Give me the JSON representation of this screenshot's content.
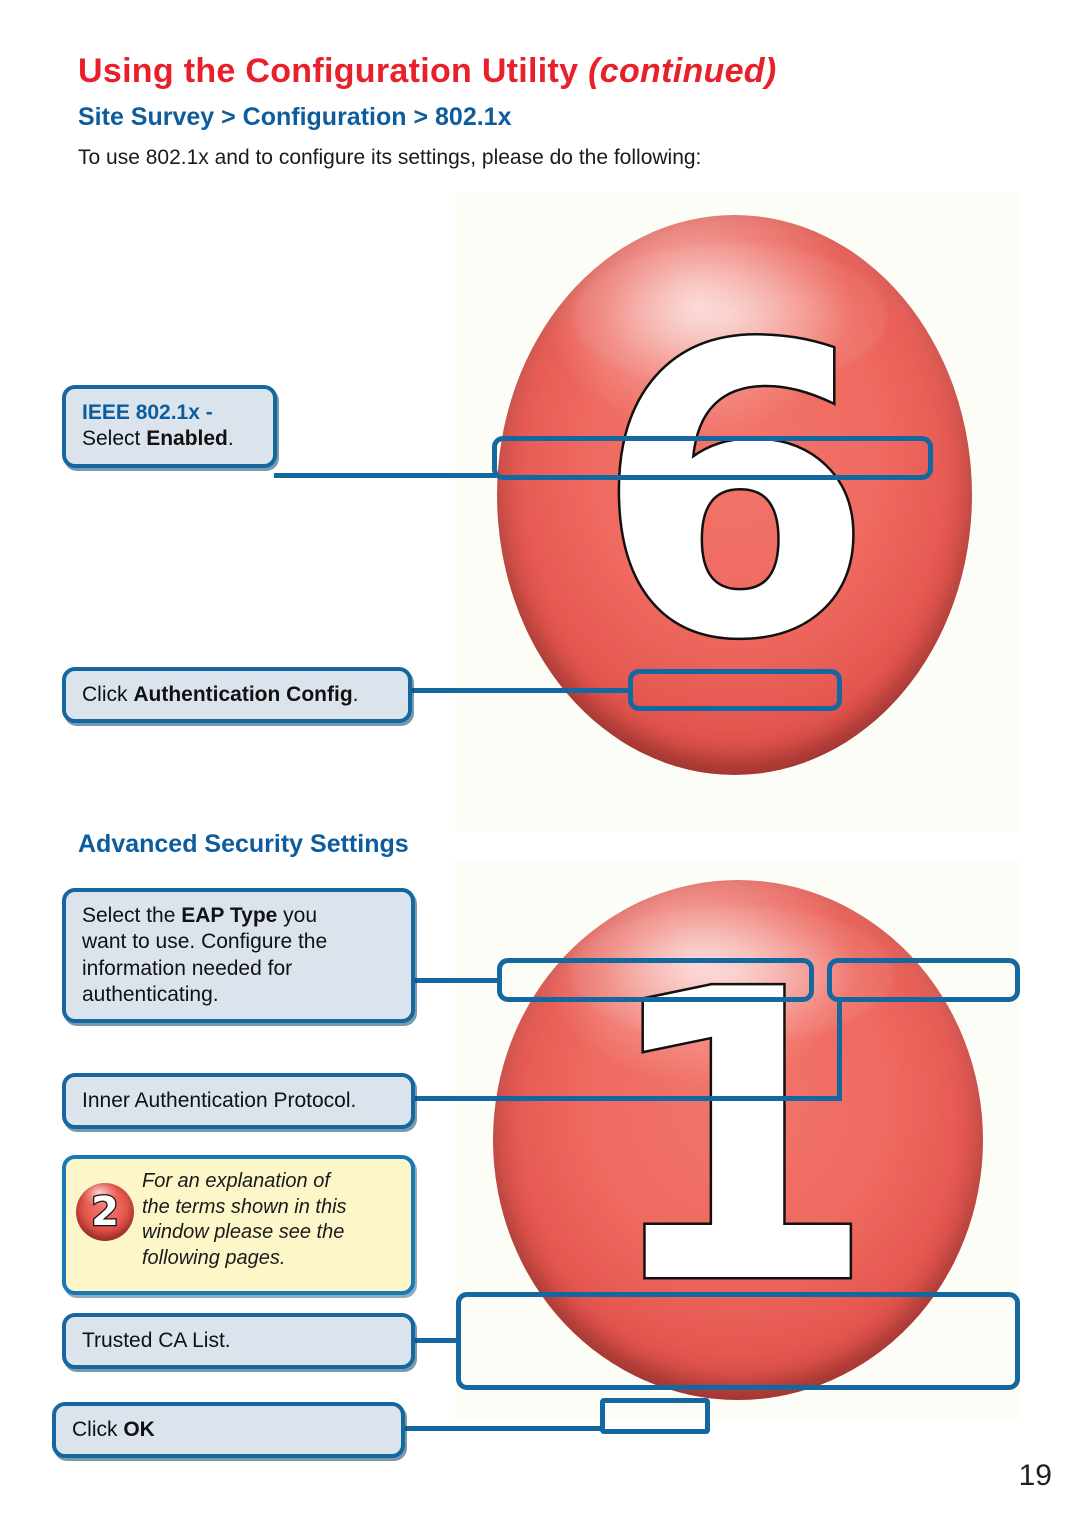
{
  "page": {
    "title_main": "Using the Configuration Utility ",
    "title_continued": "(continued)",
    "subtitle": "Site Survey > Configuration > 802.1x",
    "intro": "To use 802.1x and to configure its settings, please do the following:",
    "section_heading": "Advanced Security Settings",
    "page_number": "19"
  },
  "colors": {
    "title_red": "#e8202a",
    "heading_blue": "#0d5d9e",
    "callout_border": "#15679f",
    "callout_fill": "#dbe4ec",
    "note_fill": "#fcf6c9",
    "note_border": "#1679b8"
  },
  "upper_figure": {
    "placeholder_numeral": "6",
    "callouts": [
      {
        "id": "ieee-8021x",
        "line1": "IEEE 802.1x -",
        "line2_prefix": "Select ",
        "line2_bold": "Enabled",
        "line2_suffix": "."
      },
      {
        "id": "authentication-config",
        "prefix": "Click ",
        "bold": "Authentication Config",
        "suffix": "."
      }
    ]
  },
  "lower_figure": {
    "placeholder_numeral": "1",
    "callouts": [
      {
        "id": "eap-type",
        "line1_prefix": "Select the ",
        "line1_bold": "EAP Type",
        "line1_suffix": " you",
        "line2": "want to use. Configure the",
        "line3": "information needed for",
        "line4": "authenticating."
      },
      {
        "id": "inner-authentication-protocol",
        "text": "Inner Authentication Protocol."
      },
      {
        "id": "trusted-ca-list",
        "text": "Trusted CA List."
      },
      {
        "id": "click-ok",
        "prefix": "Click ",
        "bold": "OK"
      }
    ],
    "note": {
      "badge_number": "2",
      "line1": "For an explanation of",
      "line2": "the terms shown in this",
      "line3": "window please see the",
      "line4": "following pages."
    }
  }
}
